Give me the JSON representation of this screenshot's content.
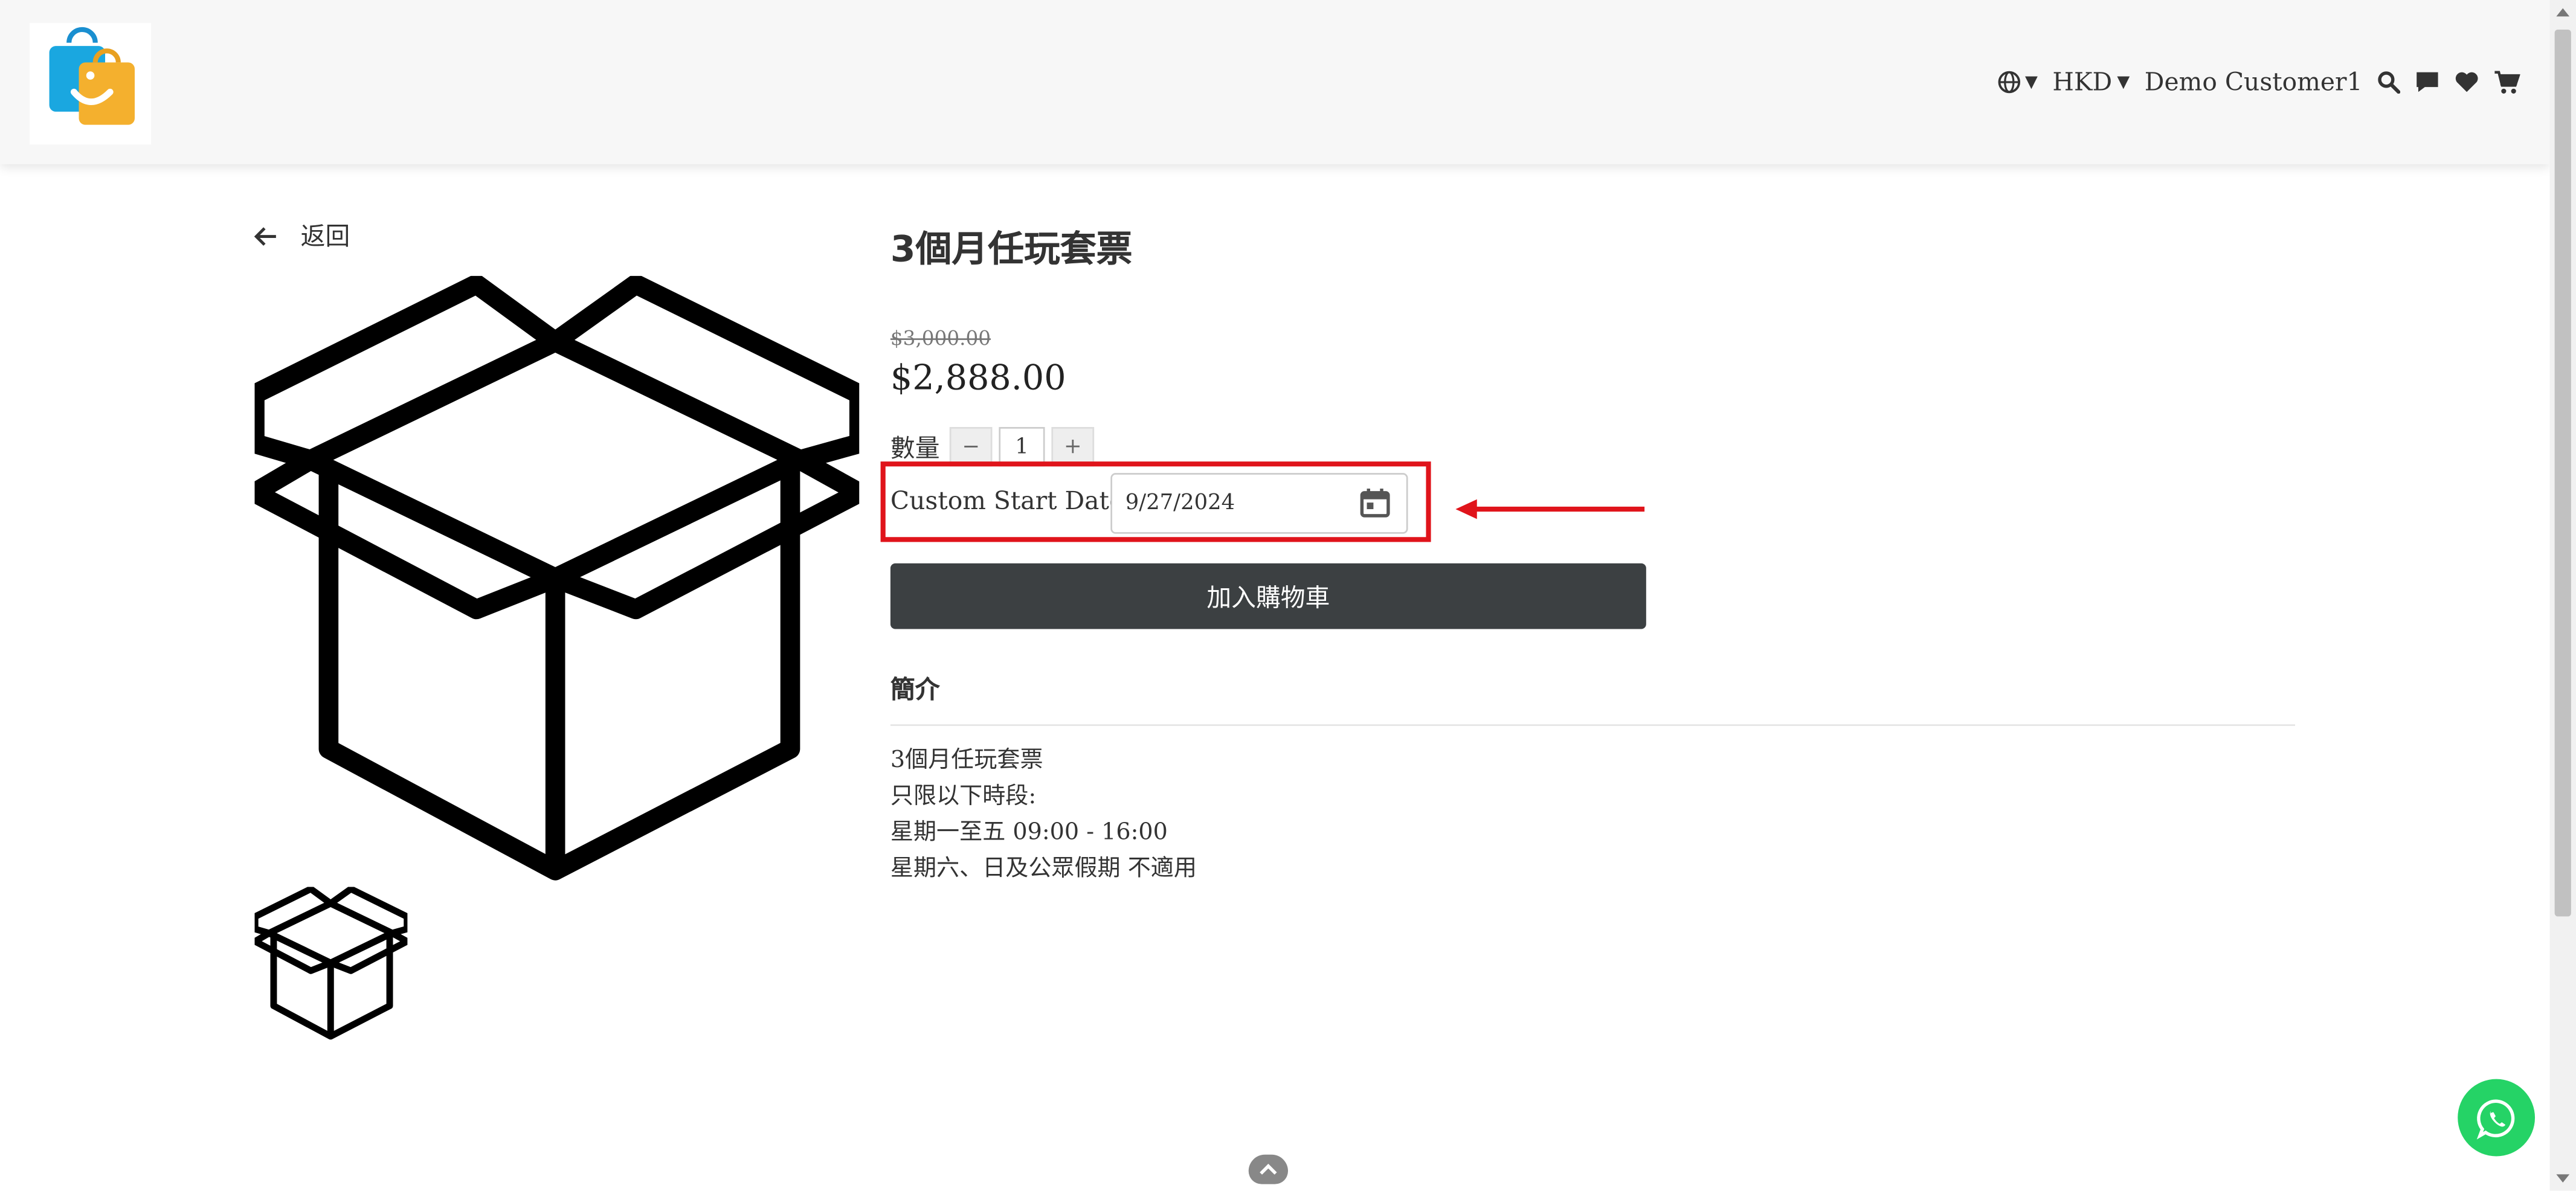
{
  "header": {
    "logo_icon": "shopping-bags-logo",
    "currency": "HKD",
    "customer_name": "Demo Customer1",
    "icons": [
      "globe-icon",
      "search-icon",
      "chat-icon",
      "heart-icon",
      "cart-icon"
    ]
  },
  "back": {
    "label": "返回"
  },
  "product": {
    "title": "3個月任玩套票",
    "original_price": "$3,000.00",
    "price": "$2,888.00",
    "quantity_label": "數量",
    "quantity_minus": "−",
    "quantity_value": "1",
    "quantity_plus": "+",
    "custom_start_date_label": "Custom Start Date",
    "custom_start_date_value": "9/27/2024",
    "add_to_cart_label": "加入購物車"
  },
  "intro": {
    "title": "簡介",
    "lines": [
      "3個月任玩套票",
      "只限以下時段:",
      "星期一至五 09:00 - 16:00",
      "星期六、日及公眾假期 不適用"
    ]
  },
  "colors": {
    "accent_highlight": "#e0141b",
    "cart_button": "#3c4042",
    "whatsapp": "#25d366"
  }
}
